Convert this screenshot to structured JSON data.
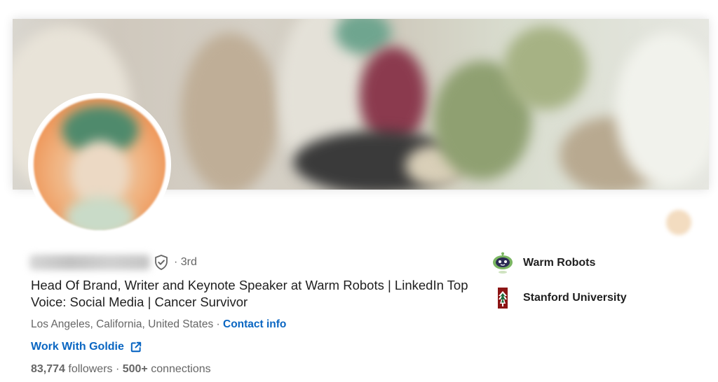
{
  "profile": {
    "degree": "· 3rd",
    "headline": "Head Of Brand, Writer and Keynote Speaker at Warm Robots | LinkedIn Top Voice: Social Media | Cancer Survivor",
    "location": "Los Angeles, California, United States",
    "location_separator": " · ",
    "contact_label": "Contact info",
    "website_label": "Work With Goldie",
    "followers_count": "83,774",
    "followers_label": " followers",
    "stats_separator": "  · ",
    "connections_count": "500+",
    "connections_label": " connections"
  },
  "orgs": [
    {
      "name": "Warm Robots",
      "icon": "warm-robots-logo"
    },
    {
      "name": "Stanford University",
      "icon": "stanford-logo"
    }
  ],
  "colors": {
    "link": "#0a66c2",
    "secondary_text": "#666666",
    "primary_text": "#1f1f1f"
  }
}
